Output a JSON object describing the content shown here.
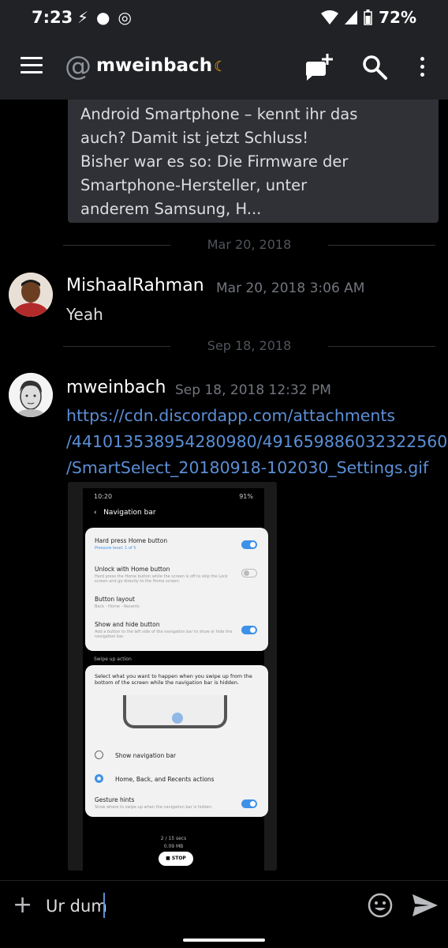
{
  "status": {
    "time": "7:23",
    "battery": "72%"
  },
  "header": {
    "at": "@",
    "title": "mweinbach",
    "moon": "☾"
  },
  "embed": {
    "lines": [
      "Android Smartphone – kennt ihr das",
      "auch? Damit ist jetzt Schluss!",
      "Bisher war es so: Die Firmware der",
      "Smartphone-Hersteller, unter",
      "anderem Samsung, H..."
    ]
  },
  "dividers": [
    "Mar 20, 2018",
    "Sep 18, 2018"
  ],
  "messages": [
    {
      "author": "MishaalRahman",
      "timestamp": "Mar 20, 2018 3:06 AM",
      "text": "Yeah"
    },
    {
      "author": "mweinbach",
      "timestamp": "Sep 18, 2018 12:32 PM",
      "link_lines": [
        "https://cdn.discordapp.com/attachments",
        "/441013538954280980/491659886032322560",
        "/SmartSelect_20180918-102030_Settings.gif"
      ]
    }
  ],
  "attachment": {
    "status_time": "10:20",
    "status_right": "91%",
    "screen_title": "Navigation bar",
    "items": [
      {
        "title": "Hard press Home button",
        "sub": "Pressure level: 1 of 5"
      },
      {
        "title": "Unlock with Home button",
        "sub": "Hard press the Home button while the screen is off to skip the Lock screen and go directly to the Home screen."
      },
      {
        "title": "Button layout",
        "sub": "Back - Home - Recents"
      },
      {
        "title": "Show and hide button",
        "sub": "Add a button to the left side of the navigation bar to show or hide the navigation bar."
      }
    ],
    "section_label": "Swipe up action",
    "section_desc": "Select what you want to happen when you swipe up from the bottom of the screen while the navigation bar is hidden.",
    "options": [
      "Show navigation bar",
      "Home, Back, and Recents actions"
    ],
    "gesture": {
      "title": "Gesture hints",
      "sub": "Show where to swipe up when the navigation bar is hidden."
    },
    "progress": "2 / 15 secs",
    "size": "0.09 MB",
    "stop": "STOP"
  },
  "input": {
    "value": "Ur dum"
  },
  "colors": {
    "link": "#5b8fd6",
    "accent_toggle": "#3e91e8",
    "bar": "#202225"
  }
}
